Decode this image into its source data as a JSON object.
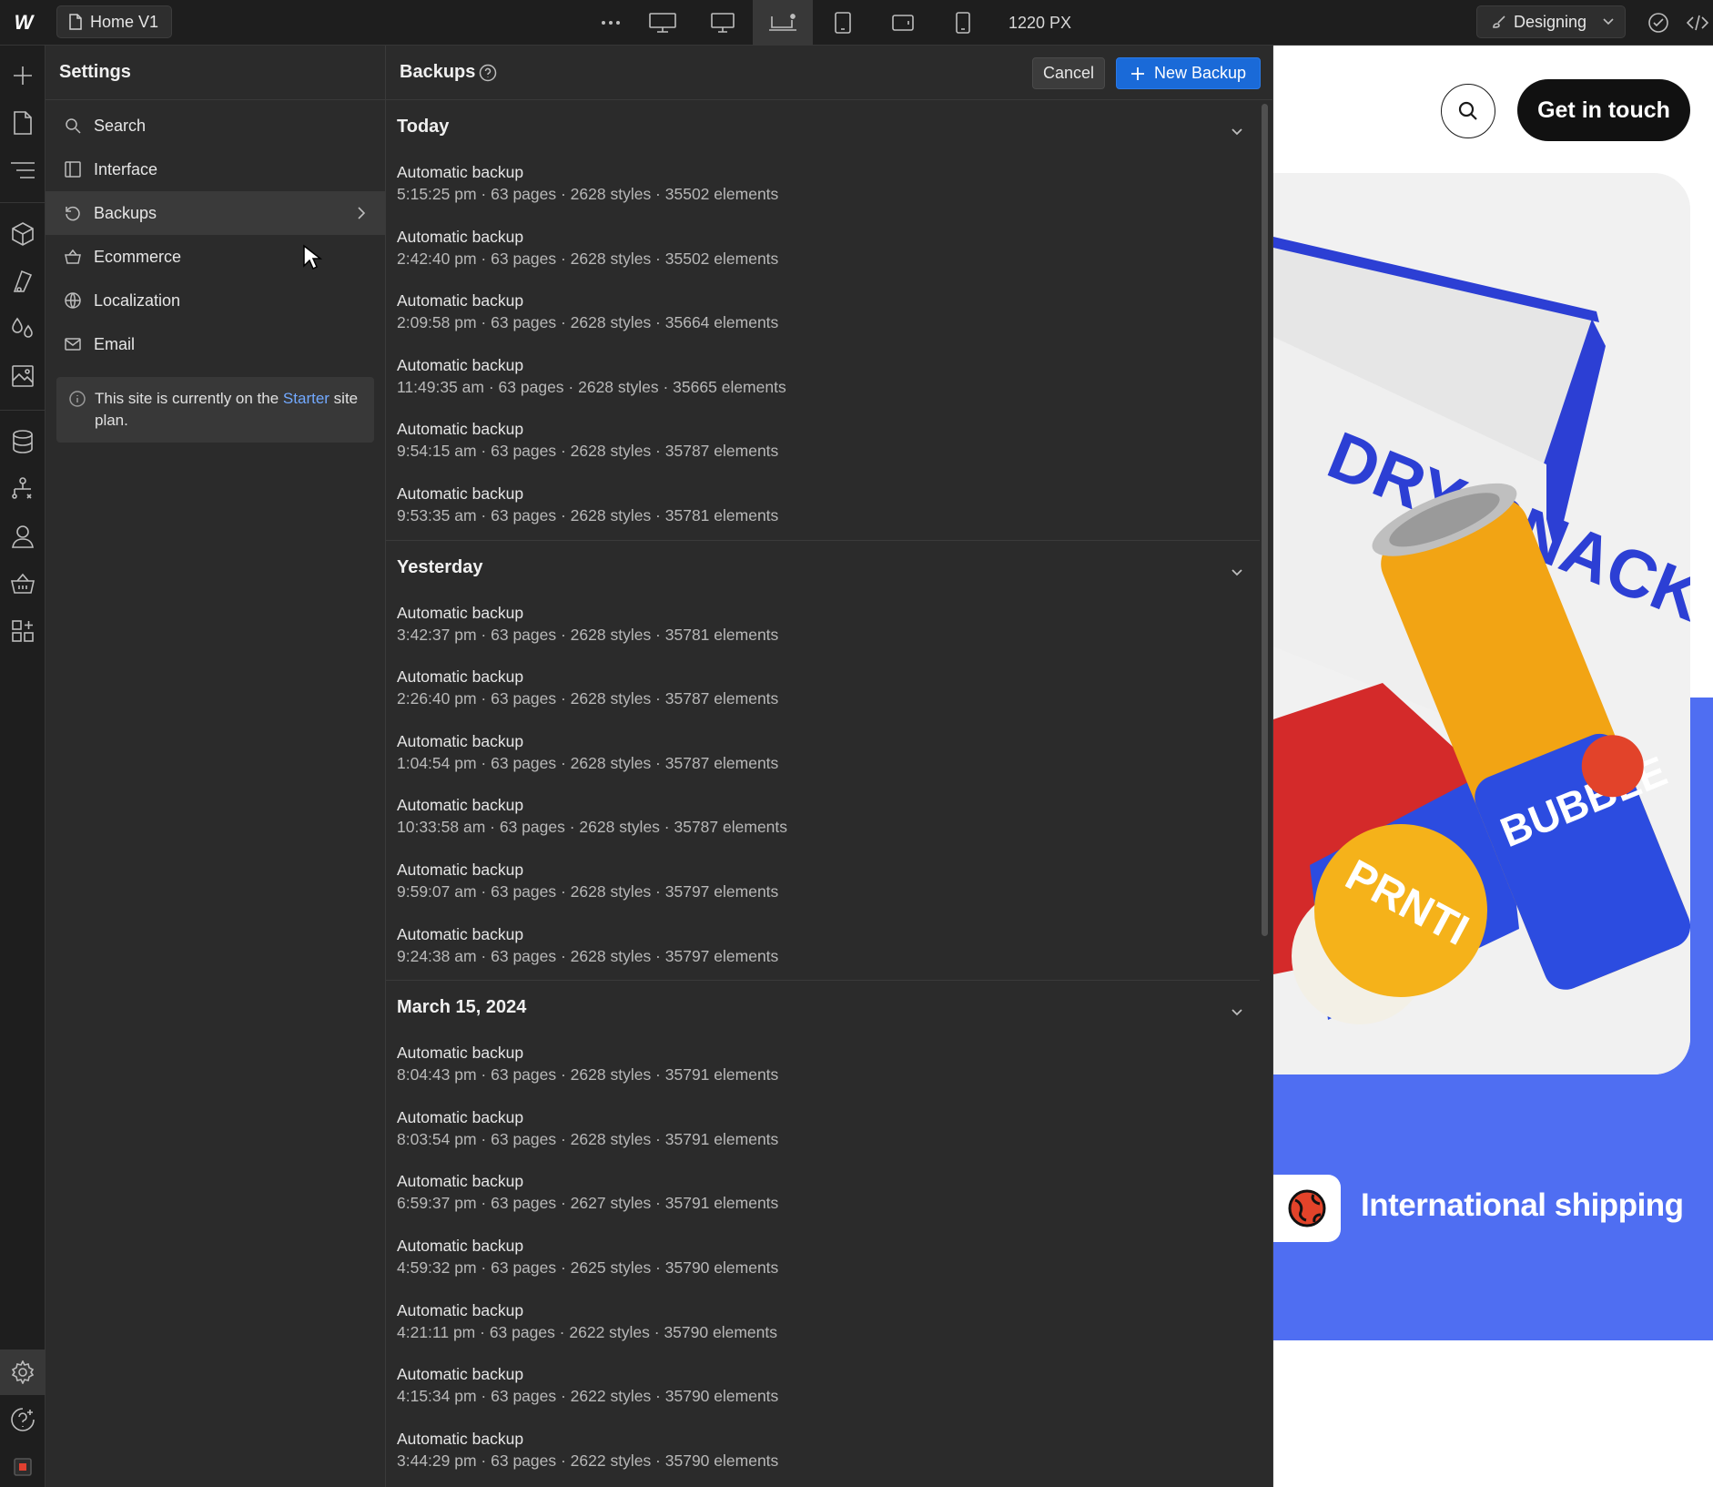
{
  "topbar": {
    "page_name": "Home V1",
    "px_readout": "1220 PX",
    "mode_label": "Designing"
  },
  "settings": {
    "title": "Settings",
    "items": [
      {
        "label": "Search",
        "icon": "search-icon"
      },
      {
        "label": "Interface",
        "icon": "layout-icon"
      },
      {
        "label": "Backups",
        "icon": "restore-icon",
        "active": true
      },
      {
        "label": "Ecommerce",
        "icon": "cart-icon"
      },
      {
        "label": "Localization",
        "icon": "globe-icon"
      },
      {
        "label": "Email",
        "icon": "mail-icon"
      }
    ],
    "plan_note": {
      "prefix": "This site is currently on the ",
      "plan_link": "Starter",
      "suffix": " site plan."
    }
  },
  "backups": {
    "title": "Backups",
    "cancel_label": "Cancel",
    "new_label": "New Backup",
    "groups": [
      {
        "label": "Today",
        "entries": [
          {
            "name": "Automatic backup",
            "meta": "5:15:25 pm · 63 pages · 2628 styles · 35502 elements"
          },
          {
            "name": "Automatic backup",
            "meta": "2:42:40 pm · 63 pages · 2628 styles · 35502 elements"
          },
          {
            "name": "Automatic backup",
            "meta": "2:09:58 pm · 63 pages · 2628 styles · 35664 elements"
          },
          {
            "name": "Automatic backup",
            "meta": "11:49:35 am · 63 pages · 2628 styles · 35665 elements"
          },
          {
            "name": "Automatic backup",
            "meta": "9:54:15 am · 63 pages · 2628 styles · 35787 elements"
          },
          {
            "name": "Automatic backup",
            "meta": "9:53:35 am · 63 pages · 2628 styles · 35781 elements"
          }
        ]
      },
      {
        "label": "Yesterday",
        "entries": [
          {
            "name": "Automatic backup",
            "meta": "3:42:37 pm · 63 pages · 2628 styles · 35781 elements"
          },
          {
            "name": "Automatic backup",
            "meta": "2:26:40 pm · 63 pages · 2628 styles · 35787 elements"
          },
          {
            "name": "Automatic backup",
            "meta": "1:04:54 pm · 63 pages · 2628 styles · 35787 elements"
          },
          {
            "name": "Automatic backup",
            "meta": "10:33:58 am · 63 pages · 2628 styles · 35787 elements"
          },
          {
            "name": "Automatic backup",
            "meta": "9:59:07 am · 63 pages · 2628 styles · 35797 elements"
          },
          {
            "name": "Automatic backup",
            "meta": "9:24:38 am · 63 pages · 2628 styles · 35797 elements"
          }
        ]
      },
      {
        "label": "March 15, 2024",
        "entries": [
          {
            "name": "Automatic backup",
            "meta": "8:04:43 pm · 63 pages · 2628 styles · 35791 elements"
          },
          {
            "name": "Automatic backup",
            "meta": "8:03:54 pm · 63 pages · 2628 styles · 35791 elements"
          },
          {
            "name": "Automatic backup",
            "meta": "6:59:37 pm · 63 pages · 2627 styles · 35791 elements"
          },
          {
            "name": "Automatic backup",
            "meta": "4:59:32 pm · 63 pages · 2625 styles · 35790 elements"
          },
          {
            "name": "Automatic backup",
            "meta": "4:21:11 pm · 63 pages · 2622 styles · 35790 elements"
          },
          {
            "name": "Automatic backup",
            "meta": "4:15:34 pm · 63 pages · 2622 styles · 35790 elements"
          },
          {
            "name": "Automatic backup",
            "meta": "3:44:29 pm · 63 pages · 2622 styles · 35790 elements"
          }
        ]
      }
    ]
  },
  "canvas": {
    "cta_label": "Get in touch",
    "shipping_label": "International shipping",
    "box_text": "DRY SNACK",
    "can_text": "BUBBLE",
    "badge_text": "PRNTI",
    "accent_color": "#4f6ef2"
  }
}
